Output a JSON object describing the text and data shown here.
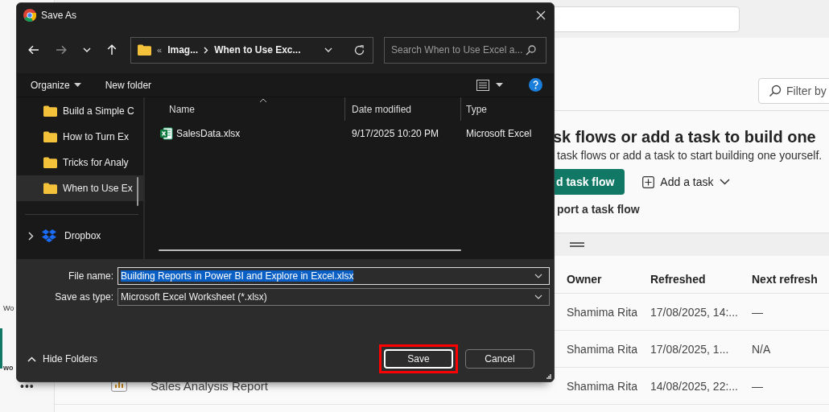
{
  "sidebar": {
    "items": [
      {
        "label": "Wo",
        "selected": false
      },
      {
        "label": "wo",
        "selected": true
      }
    ],
    "more": "•••"
  },
  "filter": {
    "placeholder": "Filter by"
  },
  "hero": {
    "heading": "sk flows or add a task to build one",
    "subtitle": "task flows or add a task to start building one yourself.",
    "primary_button": "d task flow",
    "add_task": "Add a task",
    "import_link": "port a task flow"
  },
  "table": {
    "columns": [
      "Owner",
      "Refreshed",
      "Next refresh"
    ],
    "rows": [
      {
        "owner": "Shamima Rita",
        "refreshed": "17/08/2025, 14:...",
        "next_refresh": "—"
      },
      {
        "owner": "Shamima Rita",
        "refreshed": "17/08/2025, 1...",
        "next_refresh": "N/A"
      },
      {
        "name": "Sales Analysis Report",
        "owner": "Shamima Rita",
        "refreshed": "14/08/2025, 22:...",
        "next_refresh": "—"
      }
    ]
  },
  "dialog": {
    "title": "Save As",
    "overflow": "«",
    "breadcrumb": [
      "Imag...",
      "When to Use Exc..."
    ],
    "search": {
      "placeholder": "Search When to Use Excel a..."
    },
    "toolbar": [
      "Organize",
      "New folder"
    ],
    "nav_items": [
      {
        "label": "Build a Simple C",
        "selected": false
      },
      {
        "label": "How to Turn Ex",
        "selected": false
      },
      {
        "label": "Tricks for Analy",
        "selected": false
      },
      {
        "label": "When to Use Ex",
        "selected": true
      }
    ],
    "nav_root": {
      "label": "Dropbox",
      "expanded": false
    },
    "columns": [
      "Name",
      "Date modified",
      "Type"
    ],
    "files": [
      {
        "name": "SalesData.xlsx",
        "date": "9/17/2025 10:20 PM",
        "type": "Microsoft Excel"
      }
    ],
    "file_name": {
      "label": "File name:",
      "value": "Building Reports in Power BI and Explore in Excel.xlsx",
      "text_selected": true
    },
    "save_as_type": {
      "label": "Save as type:",
      "value": "Microsoft Excel Worksheet (*.xlsx)"
    },
    "hide_folders": "Hide Folders",
    "buttons": [
      {
        "label": "Save",
        "kind": "primary",
        "highlighted": true
      },
      {
        "label": "Cancel",
        "kind": "secondary",
        "highlighted": false
      }
    ]
  }
}
